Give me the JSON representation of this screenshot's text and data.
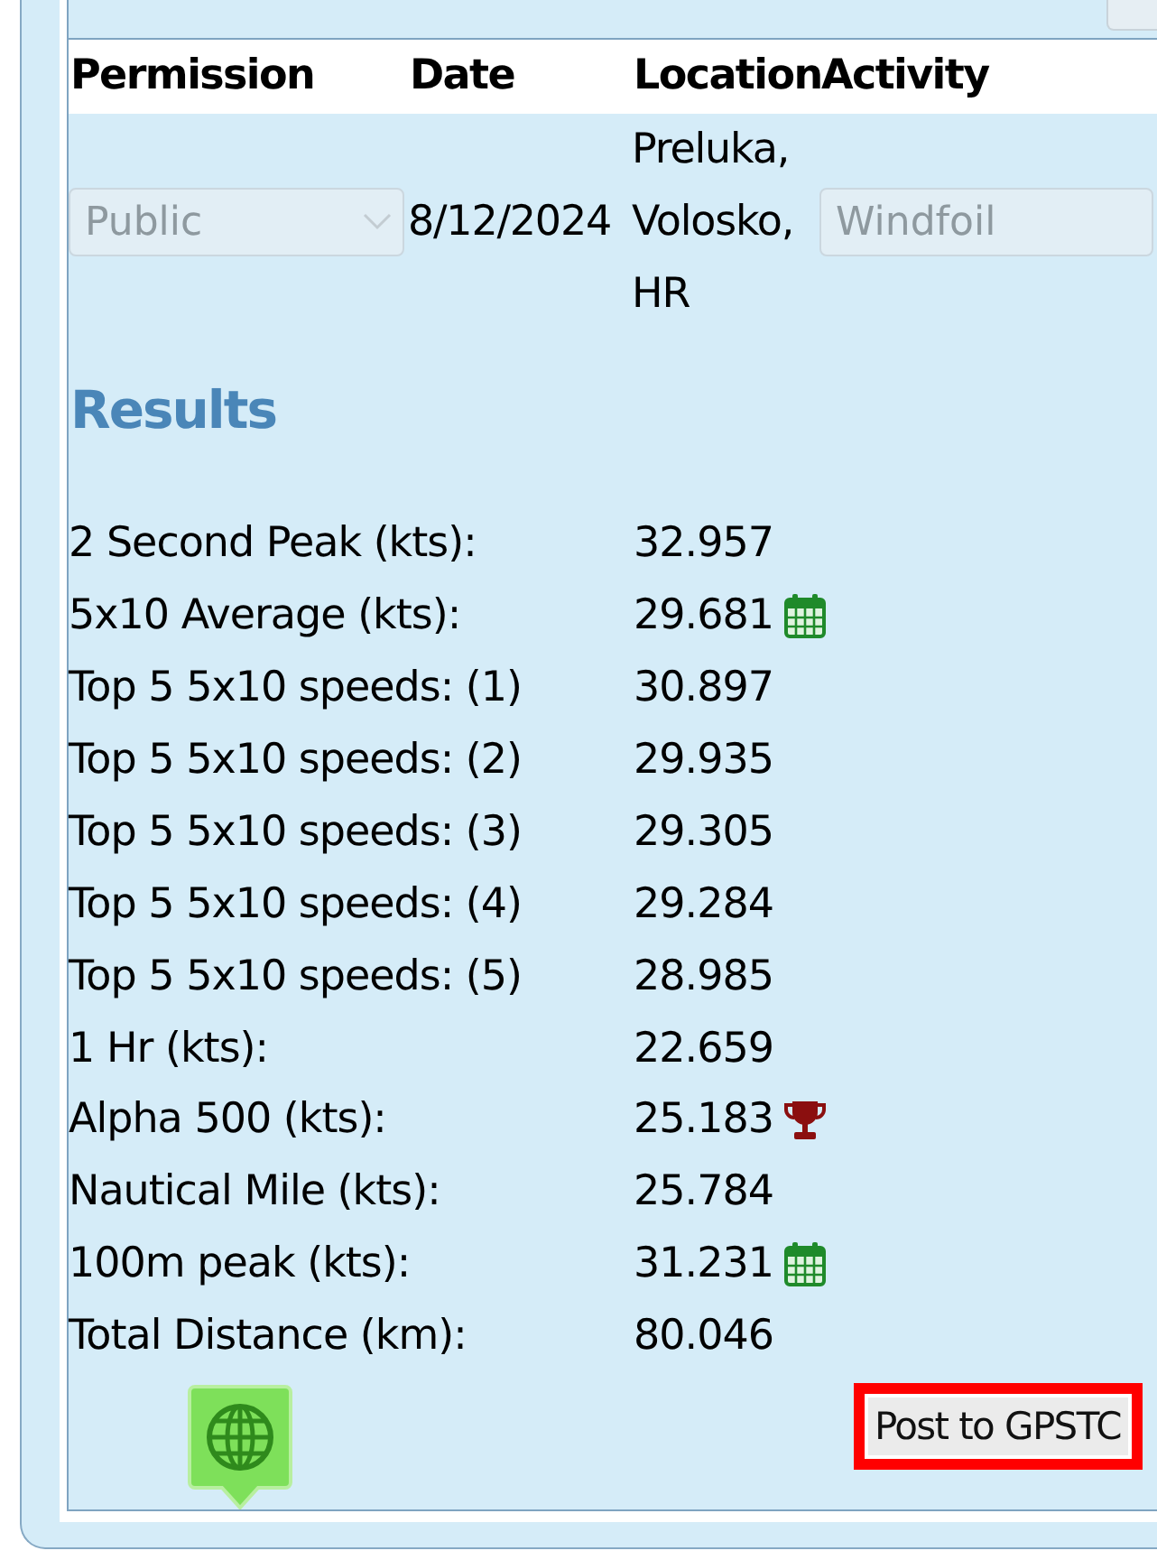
{
  "table": {
    "columns": [
      "Permission",
      "Date",
      "Location",
      "Activity"
    ],
    "row": {
      "permission": {
        "value": "Public",
        "disabled": true
      },
      "date": "8/12/2024",
      "location": [
        "Preluka,",
        "Volosko,",
        "HR"
      ],
      "activity": {
        "value": "Windfoil",
        "disabled": true
      }
    }
  },
  "results": {
    "title": "Results",
    "rows": [
      {
        "label": "2 Second Peak (kts):",
        "value": "32.957",
        "kind": "plain"
      },
      {
        "label": "5x10 Average (kts):",
        "value": "29.681",
        "kind": "calendar"
      },
      {
        "label": "Top 5 5x10 speeds: (1)",
        "value": "30.897",
        "kind": "plain"
      },
      {
        "label": "Top 5 5x10 speeds: (2)",
        "value": "29.935",
        "kind": "plain"
      },
      {
        "label": "Top 5 5x10 speeds: (3)",
        "value": "29.305",
        "kind": "plain"
      },
      {
        "label": "Top 5 5x10 speeds: (4)",
        "value": "29.284",
        "kind": "plain"
      },
      {
        "label": "Top 5 5x10 speeds: (5)",
        "value": "28.985",
        "kind": "plain"
      },
      {
        "label": "1 Hr (kts):",
        "value": "22.659",
        "kind": "plain"
      },
      {
        "label": "Alpha 500 (kts):",
        "value": "25.183",
        "kind": "trophy"
      },
      {
        "label": "Nautical Mile (kts):",
        "value": "25.784",
        "kind": "plain"
      },
      {
        "label": "100m peak (kts):",
        "value": "31.231",
        "kind": "calendar"
      },
      {
        "label": "Total Distance (km):",
        "value": "80.046",
        "kind": "plain"
      }
    ]
  },
  "post_button": {
    "label": "Post to GPSTC",
    "highlighted": true
  }
}
